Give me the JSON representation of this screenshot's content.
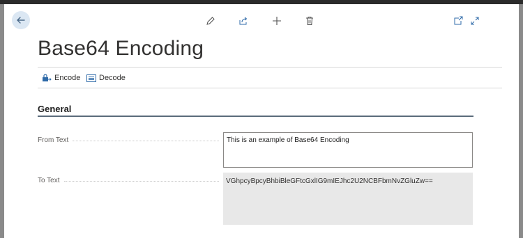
{
  "page": {
    "title": "Base64 Encoding"
  },
  "toolbar": {
    "icons": [
      "back-arrow-icon",
      "edit-pencil-icon",
      "share-icon",
      "add-plus-icon",
      "delete-trash-icon",
      "open-new-window-icon",
      "expand-icon"
    ]
  },
  "actions": [
    {
      "label": "Encode",
      "icon": "lock-encode-icon"
    },
    {
      "label": "Decode",
      "icon": "decode-card-icon"
    }
  ],
  "section": {
    "title": "General"
  },
  "fields": {
    "from_text": {
      "label": "From Text",
      "value": "This is an example of Base64 Encoding"
    },
    "to_text": {
      "label": "To Text",
      "value": "VGhpcyBpcyBhbiBleGFtcGxlIG9mIEJhc2U2NCBFbmNvZGluZw=="
    }
  },
  "colors": {
    "accent": "#2e6aa8",
    "section_underline": "#5b6b7b",
    "readonly_bg": "#e8e8e8"
  }
}
